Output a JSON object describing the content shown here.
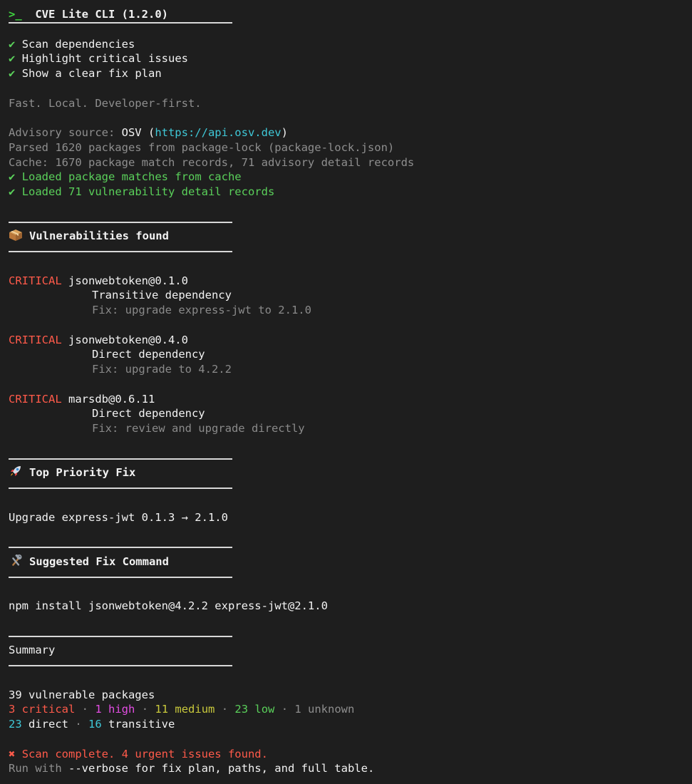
{
  "header": {
    "prompt_glyph": ">_",
    "title": "CVE Lite CLI (1.2.0)"
  },
  "features": [
    "Scan dependencies",
    "Highlight critical issues",
    "Show a clear fix plan"
  ],
  "check_glyph": "✔",
  "tagline": "Fast. Local. Developer-first.",
  "advisory": {
    "label": "Advisory source: ",
    "source": "OSV",
    "paren_open": " (",
    "url": "https://api.osv.dev",
    "paren_close": ")"
  },
  "parsed_line": "Parsed 1620 packages from package-lock (package-lock.json)",
  "cache_line": "Cache: 1670 package match records, 71 advisory detail records",
  "loaded_lines": [
    "Loaded package matches from cache",
    "Loaded 71 vulnerability detail records"
  ],
  "sections": {
    "vulns_title": "Vulnerabilities found",
    "top_fix_title": "Top Priority Fix",
    "suggested_title": "Suggested Fix Command",
    "summary_title": "Summary"
  },
  "icons": {
    "vulns": "package-icon",
    "top_fix": "rocket-icon",
    "suggested": "tools-icon"
  },
  "vulnerabilities": [
    {
      "severity": "CRITICAL",
      "package": "jsonwebtoken@0.1.0",
      "dependency": "Transitive dependency",
      "fix": "Fix: upgrade express-jwt to 2.1.0"
    },
    {
      "severity": "CRITICAL",
      "package": "jsonwebtoken@0.4.0",
      "dependency": "Direct dependency",
      "fix": "Fix: upgrade to 4.2.2"
    },
    {
      "severity": "CRITICAL",
      "package": "marsdb@0.6.11",
      "dependency": "Direct dependency",
      "fix": "Fix: review and upgrade directly"
    }
  ],
  "top_fix_text": "Upgrade express-jwt 0.1.3 → 2.1.0",
  "fix_command": "npm install jsonwebtoken@4.2.2 express-jwt@2.1.0",
  "summary": {
    "vulnerable_line": "39 vulnerable packages",
    "sep": " · ",
    "critical_count": "3",
    "critical_label": " critical",
    "high_count": "1",
    "high_label": " high",
    "medium_count": "11",
    "medium_label": " medium",
    "low_count": "23",
    "low_label": " low",
    "unknown_text": "1 unknown",
    "direct_count": "23",
    "direct_label": " direct",
    "transitive_count": "16",
    "transitive_label": " transitive"
  },
  "footer": {
    "x_glyph": "✖",
    "complete_text": "Scan complete. 4 urgent issues found.",
    "run_prefix": "Run with ",
    "run_flag": "--verbose",
    "run_suffix": " for fix plan, paths, and full table."
  },
  "colors": {
    "background": "#1e1e1e",
    "foreground": "#f2f2f2",
    "green": "#5ad05a",
    "gray": "#8e8e8e",
    "critical": "#ff5a4a",
    "high": "#e34de3",
    "medium": "#c9c93c",
    "cyan": "#3fc7d6"
  }
}
